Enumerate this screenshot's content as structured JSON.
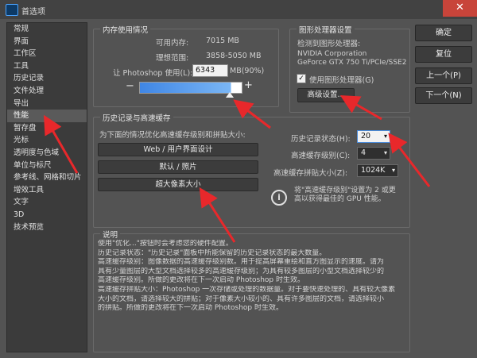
{
  "window": {
    "title": "首选项",
    "close_glyph": "✕"
  },
  "sidebar": {
    "items": [
      "常规",
      "界面",
      "工作区",
      "工具",
      "历史记录",
      "文件处理",
      "导出",
      "性能",
      "暂存盘",
      "光标",
      "透明度与色域",
      "单位与标尺",
      "参考线、网格和切片",
      "增效工具",
      "文字",
      "3D",
      "技术预览"
    ],
    "active_index": 7
  },
  "memory": {
    "legend": "内存使用情况",
    "available_label": "可用内存:",
    "available_value": "7015 MB",
    "ideal_label": "理想范围:",
    "ideal_value": "3858-5050 MB",
    "use_label": "让 Photoshop 使用(L):",
    "use_value": "6343",
    "use_unit": "MB(90%)",
    "minus": "−",
    "plus": "+",
    "slider_fraction": 0.9
  },
  "gpu": {
    "legend": "图形处理器设置",
    "detected_label": "检测到图形处理器:",
    "vendor": "NVIDIA Corporation",
    "model": "GeForce GTX 750 Ti/PCIe/SSE2",
    "use_gpu_label": "使用图形处理器(G)",
    "use_gpu_checked": "✓",
    "advanced_button": "高级设置..."
  },
  "history": {
    "legend": "历史记录与高速缓存",
    "optimize_label": "为下面的情况优化高速缓存级别和拼贴大小:",
    "preset_buttons": [
      "Web / 用户界面设计",
      "默认 / 照片",
      "超大像素大小"
    ],
    "states_label": "历史记录状态(H):",
    "states_value": "20",
    "cache_levels_label": "高速缓存级别(C):",
    "cache_levels_value": "4",
    "tile_size_label": "高速缓存拼贴大小(Z):",
    "tile_size_value": "1024K",
    "hint_line1": "将\"高速缓存级别\"设置为 2 或更",
    "hint_line2": "高以获得最佳的 GPU 性能。"
  },
  "description": {
    "legend": "说明",
    "lines": [
      "使用\"优化...\"按钮时会考虑您的硬件配置。",
      "历史记录状态：\"历史记录\"面板中所能保留的历史记录状态的最大数量。",
      "高速缓存级别：图像数据的高速缓存级别数。用于提高屏幕重绘和直方图显示的速度。请为",
      "具有少量图层的大型文档选择较多的高速缓存级别；为具有较多图层的小型文档选择较少的",
      "高速缓存级别。所做的更改将在下一次启动 Photoshop 时生效。",
      "高速缓存拼贴大小：Photoshop 一次存储或处理的数据量。对于要快速处理的、具有较大像素",
      "大小的文档，请选择较大的拼贴；对于像素大小较小的、具有许多图层的文档，请选择较小",
      "的拼贴。所做的更改将在下一次启动 Photoshop 时生效。"
    ]
  },
  "right_buttons": {
    "ok": "确定",
    "reset": "复位",
    "prev": "上一个(P)",
    "next": "下一个(N)"
  },
  "colors": {
    "annotation_arrow": "#e8282b",
    "accent": "#3f86e5"
  }
}
